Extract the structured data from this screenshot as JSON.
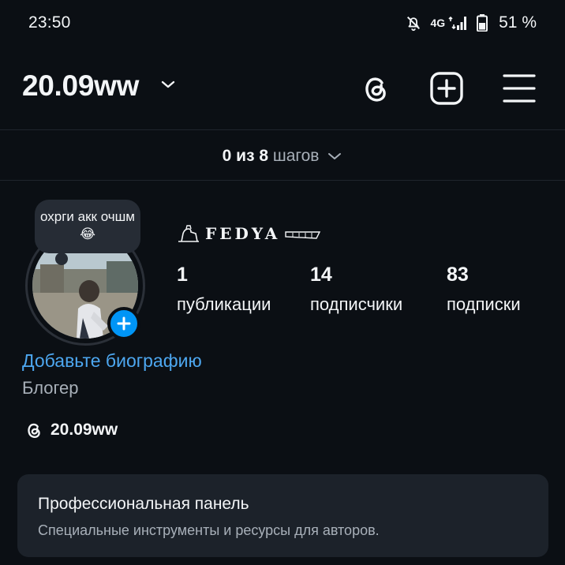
{
  "status_bar": {
    "time": "23:50",
    "network": "4G",
    "battery_percent": "51 %",
    "icons": [
      "bell-off-icon",
      "signal-icon",
      "battery-icon"
    ]
  },
  "header": {
    "username": "20.09ww",
    "icons": [
      "chevron-down-icon",
      "threads-icon",
      "add-square-icon",
      "menu-icon"
    ]
  },
  "steps": {
    "count": "0 из 8",
    "word": "шагов"
  },
  "profile": {
    "note": "охрги акк очшм 😂",
    "display_name": "FEDYA",
    "stats": [
      {
        "value": "1",
        "label": "публикации"
      },
      {
        "value": "14",
        "label": "подписчики"
      },
      {
        "value": "83",
        "label": "подписки"
      }
    ],
    "bio_link": "Добавьте биографию",
    "category": "Блогер",
    "threads_handle": "20.09ww"
  },
  "pro_panel": {
    "title": "Профессиональная панель",
    "subtitle": "Специальные инструменты и ресурсы для авторов."
  },
  "colors": {
    "background": "#0b0f14",
    "accent": "#0095f6",
    "link": "#4da7f0",
    "panel": "#1c222a",
    "muted_text": "#a8b0b9"
  }
}
